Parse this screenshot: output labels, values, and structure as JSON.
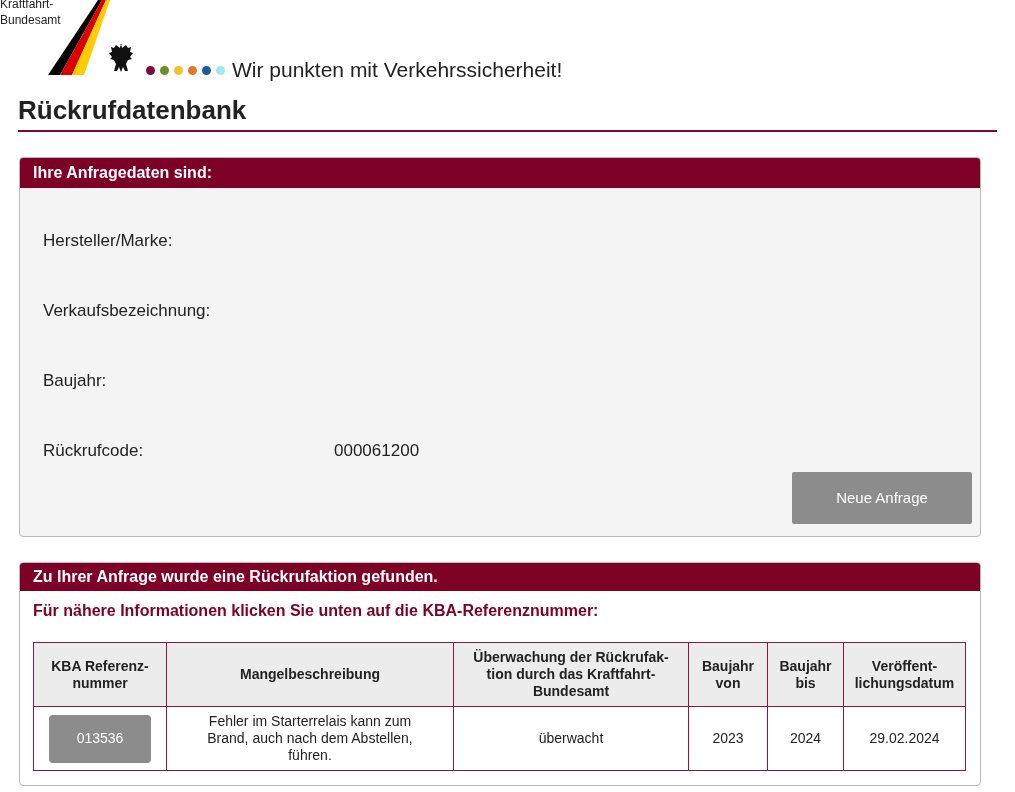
{
  "header": {
    "agency_name": "Kraftfahrt-\nBundesamt",
    "slogan": "Wir punkten mit Verkehrssicherheit!",
    "dots": [
      {
        "color": "#7d0a3c"
      },
      {
        "color": "#6a8f2a"
      },
      {
        "color": "#f2c12e"
      },
      {
        "color": "#e07a2a"
      },
      {
        "color": "#1f5aa0"
      },
      {
        "color": "#9ee8f0"
      }
    ]
  },
  "page_title": "Rückrufdatenbank",
  "query_panel": {
    "title": "Ihre Anfragedaten sind:",
    "fields": [
      {
        "label": "Hersteller/Marke:"
      },
      {
        "label": "Verkaufsbezeichnung:"
      },
      {
        "label": "Baujahr:"
      },
      {
        "label": "Rückrufcode:",
        "value": "000061200"
      }
    ],
    "button": "Neue Anfrage"
  },
  "result_panel": {
    "title": "Zu Ihrer Anfrage wurde eine Rückrufaktion gefunden.",
    "hint": "Für nähere Informationen klicken Sie unten auf die KBA-Referenznummer:",
    "table": {
      "columns": [
        "KBA Referenz-\nnummer",
        "Mangelbeschreibung",
        "Überwachung der Rückrufak-\ntion durch das Kraftfahrt-\nBundesamt",
        "Baujahr\nvon",
        "Baujahr\nbis",
        "Veröffent-\nlichungsdatum"
      ],
      "rows": [
        {
          "reference": "013536",
          "defect": "Fehler im Starterrelais kann zum\nBrand, auch nach dem Abstellen,\nführen.",
          "monitoring": "überwacht",
          "year_from": "2023",
          "year_to": "2024",
          "published": "29.02.2024"
        }
      ]
    }
  }
}
